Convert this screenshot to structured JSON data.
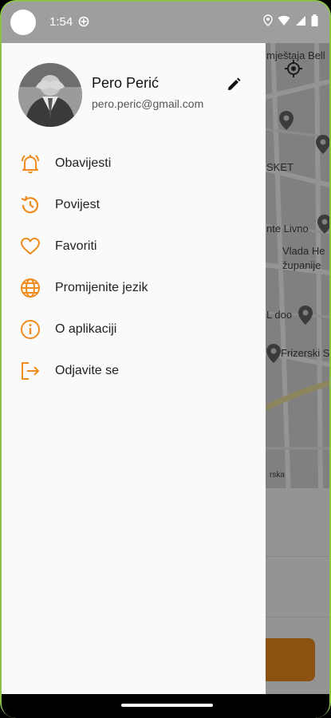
{
  "status_bar": {
    "time": "1:54",
    "icons": [
      "data-saver-icon",
      "location-icon",
      "wifi-icon",
      "signal-icon",
      "battery-icon"
    ]
  },
  "map": {
    "labels": [
      "mještaja Bell",
      "SKET",
      "nte Livno",
      "Vlada He",
      "županije",
      "L doo",
      "Frizerski S",
      "rska"
    ],
    "pins": [
      "map-pin-icon",
      "map-pin-icon",
      "map-pin-icon",
      "map-pin-icon",
      "map-pin-icon"
    ]
  },
  "drawer": {
    "user": {
      "name": "Pero Perić",
      "email": "pero.peric@gmail.com"
    },
    "menu": [
      {
        "label": "Obavijesti",
        "icon": "bell-icon"
      },
      {
        "label": "Povijest",
        "icon": "history-icon"
      },
      {
        "label": "Favoriti",
        "icon": "heart-icon"
      },
      {
        "label": "Promijenite jezik",
        "icon": "globe-icon"
      },
      {
        "label": "O aplikaciji",
        "icon": "info-icon"
      },
      {
        "label": "Odjavite se",
        "icon": "logout-icon"
      }
    ]
  },
  "colors": {
    "accent": "#f08c1e",
    "frame": "#8bc34a",
    "status_bar": "#9e9e9e",
    "drawer_bg": "#fafafa"
  }
}
